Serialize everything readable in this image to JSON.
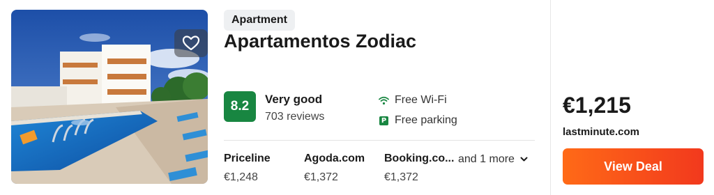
{
  "listing": {
    "type_badge": "Apartment",
    "name": "Apartamentos Zodiac",
    "favorite_icon": "heart-icon",
    "rating": {
      "score": "8.2",
      "label": "Very good",
      "reviews": "703 reviews",
      "color": "#188641"
    },
    "amenities": [
      {
        "label": "Free Wi-Fi",
        "icon": "wifi-icon"
      },
      {
        "label": "Free parking",
        "icon": "parking-icon"
      }
    ],
    "providers": [
      {
        "name": "Priceline",
        "price": "€1,248"
      },
      {
        "name": "Agoda.com",
        "price": "€1,372"
      },
      {
        "name": "Booking.co...",
        "price": "€1,372"
      }
    ],
    "more_label": "and 1 more",
    "best": {
      "price": "€1,215",
      "site": "lastminute.com",
      "button_label": "View Deal",
      "button_color": "#f2391d"
    }
  }
}
